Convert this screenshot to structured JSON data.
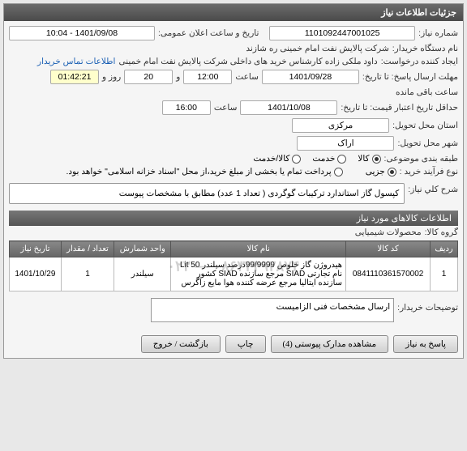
{
  "panel_title": "جزئیات اطلاعات نیاز",
  "fields": {
    "need_number_label": "شماره نیاز:",
    "need_number": "1101092447001025",
    "public_date_label": "تاریخ و ساعت اعلان عمومی:",
    "public_date": "1401/09/08 - 10:04",
    "buyer_org_label": "نام دستگاه خریدار:",
    "buyer_org": "شرکت پالایش نفت امام خمینی ره شازند",
    "requester_label": "ایجاد کننده درخواست:",
    "requester": "داود ملکی زاده کارشناس خرید های داخلی شرکت پالایش نفت امام خمینی",
    "contact_link": "اطلاعات تماس خریدار",
    "deadline_label": "مهلت ارسال پاسخ: تا تاریخ:",
    "deadline_date": "1401/09/28",
    "time_label": "ساعت",
    "deadline_time": "12:00",
    "and_label": "و",
    "days": "20",
    "day_label": "روز و",
    "remaining_time": "01:42:21",
    "remaining_label": "ساعت باقی مانده",
    "validity_label": "حداقل تاریخ اعتبار قیمت: تا تاریخ:",
    "validity_date": "1401/10/08",
    "validity_time": "16:00",
    "province_label": "استان محل تحویل:",
    "province": "مرکزی",
    "city_label": "شهر محل تحویل:",
    "city": "اراک",
    "category_label": "طبقه بندی موضوعی:",
    "cat_goods": "کالا",
    "cat_service": "خدمت",
    "cat_goods_service": "کالا/خدمت",
    "process_label": "نوع فرآیند خرید :",
    "proc_partial": "جزیی",
    "proc_note": "پرداخت تمام یا بخشی از مبلغ خرید،از محل \"اسناد خزانه اسلامی\" خواهد بود.",
    "desc_label": "شرح کلي نياز:",
    "desc_text": "کپسول گاز استاندارد ترکیبات گوگردی ( تعداد 1 عدد) مطابق با مشخصات پیوست",
    "items_header": "اطلاعات کالاهای مورد نیاز",
    "group_label": "گروه کالا:",
    "group_value": "محصولات شیمیایی",
    "buyer_note_label": "توضیحات خریدار:",
    "buyer_note": "ارسال مشخصات فنی الزامیست"
  },
  "table": {
    "headers": {
      "row": "ردیف",
      "code": "کد کالا",
      "name": "نام کالا",
      "unit": "واحد شمارش",
      "qty": "تعداد / مقدار",
      "need_date": "تاریخ نیاز"
    },
    "rows": [
      {
        "row": "1",
        "code": "0841110361570002",
        "name": "هیدروژن گاز خلوص 99/9999درصد سیلندر Lit 50 نام تجارتی SIAD مرجع سازنده SIAD کشور سازنده ایتالیا مرجع عرضه کننده هوا مایع زاگرس",
        "unit": "سیلندر",
        "qty": "1",
        "need_date": "1401/10/29"
      }
    ]
  },
  "watermark": "۰۸۶۳۳۴۹۲۸۷۴ — ۰۲۲",
  "buttons": {
    "back": "پاسخ به نیاز",
    "attachments": "مشاهده مدارک پیوستی (4)",
    "print": "چاپ",
    "exit": "بازگشت / خروج"
  }
}
